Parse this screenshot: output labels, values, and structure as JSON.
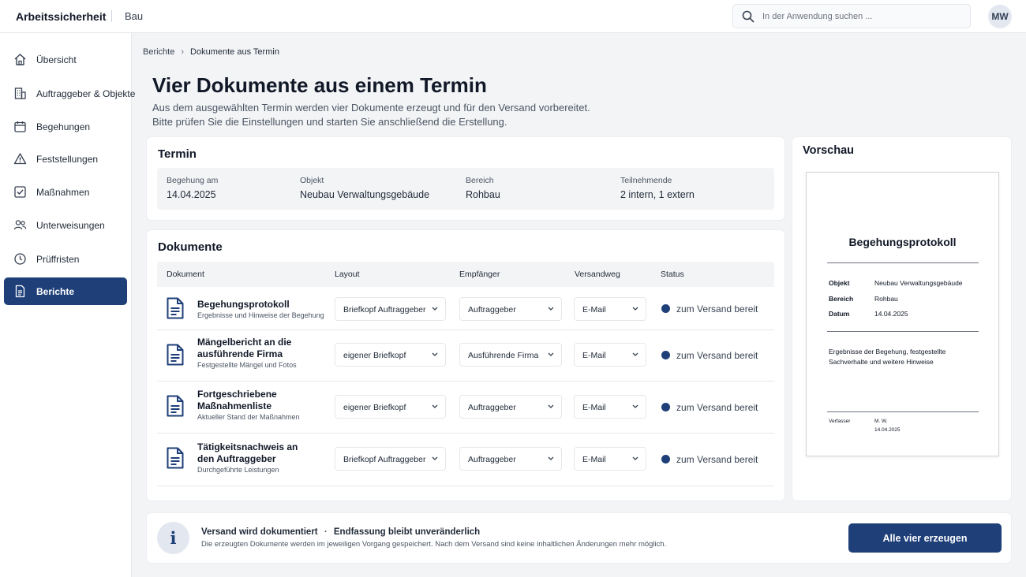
{
  "app": {
    "title": "Arbeitssicherheit",
    "subtitle": "Bau"
  },
  "search": {
    "placeholder": "In der Anwendung suchen ..."
  },
  "user": {
    "initials": "MW"
  },
  "colors": {
    "primary": "#1e3f78",
    "status_dot": "#1e3f78"
  },
  "sidebar": {
    "items": [
      {
        "label": "Übersicht",
        "icon": "home-icon",
        "active": false
      },
      {
        "label": "Auftraggeber & Objekte",
        "icon": "building-icon",
        "active": false
      },
      {
        "label": "Begehungen",
        "icon": "calendar-icon",
        "active": false
      },
      {
        "label": "Feststellungen",
        "icon": "warning-icon",
        "active": false
      },
      {
        "label": "Maßnahmen",
        "icon": "checkbox-icon",
        "active": false
      },
      {
        "label": "Unterweisungen",
        "icon": "users-icon",
        "active": false
      },
      {
        "label": "Prüffristen",
        "icon": "clock-icon",
        "active": false
      },
      {
        "label": "Berichte",
        "icon": "document-icon",
        "active": true
      }
    ]
  },
  "breadcrumb": {
    "parent": "Berichte",
    "separator": "›",
    "current": "Dokumente aus Termin"
  },
  "page": {
    "title": "Vier Dokumente aus einem Termin",
    "intro_1": "Aus dem ausgewählten Termin werden vier Dokumente erzeugt und für den Versand vorbereitet.",
    "intro_2": "Bitte prüfen Sie die Einstellungen und starten Sie anschließend die Erstellung."
  },
  "termin": {
    "heading": "Termin",
    "fields": [
      {
        "label": "Begehung am",
        "value": "14.04.2025"
      },
      {
        "label": "Objekt",
        "value": "Neubau Verwaltungsgebäude"
      },
      {
        "label": "Bereich",
        "value": "Rohbau"
      },
      {
        "label": "Teilnehmende",
        "value": "2 intern, 1 extern"
      }
    ]
  },
  "documents": {
    "heading": "Dokumente",
    "columns": {
      "doc": "Dokument",
      "layout": "Layout",
      "recipient": "Empfänger",
      "channel": "Versandweg",
      "status": "Status"
    },
    "rows": [
      {
        "name": "Begehungsprotokoll",
        "desc": "Ergebnisse und Hinweise der Begehung",
        "layout": "Briefkopf Auftraggeber",
        "recipient": "Auftraggeber",
        "channel": "E-Mail",
        "status": "zum Versand bereit"
      },
      {
        "name": "Mängelbericht an die ausführende Firma",
        "desc": "Festgestellte Mängel und Fotos",
        "layout": "eigener Briefkopf",
        "recipient": "Ausführende Firma",
        "channel": "E-Mail",
        "status": "zum Versand bereit"
      },
      {
        "name": "Fortgeschriebene Maßnahmenliste",
        "desc": "Aktueller Stand der Maßnahmen",
        "layout": "eigener Briefkopf",
        "recipient": "Auftraggeber",
        "channel": "E-Mail",
        "status": "zum Versand bereit"
      },
      {
        "name": "Tätigkeitsnachweis an den Auftraggeber",
        "desc": "Durchgeführte Leistungen",
        "layout": "Briefkopf Auftraggeber",
        "recipient": "Auftraggeber",
        "channel": "E-Mail",
        "status": "zum Versand bereit"
      }
    ]
  },
  "preview": {
    "heading": "Vorschau",
    "doc_title": "Begehungsprotokoll",
    "fields": [
      {
        "label": "Objekt",
        "value": "Neubau Verwaltungsgebäude"
      },
      {
        "label": "Bereich",
        "value": "Rohbau"
      },
      {
        "label": "Datum",
        "value": "14.04.2025"
      }
    ],
    "text": "Ergebnisse der Begehung, festgestellte Sachverhalte und weitere Hinweise",
    "author_label": "Verfasser",
    "author": "M. W.",
    "author_date": "14.04.2025"
  },
  "footer": {
    "info_glyph": "i",
    "title_1": "Versand wird dokumentiert",
    "title_sep": "·",
    "title_2": "Endfassung bleibt unveränderlich",
    "subtitle": "Die erzeugten Dokumente werden im jeweiligen Vorgang gespeichert. Nach dem Versand sind keine inhaltlichen Änderungen mehr möglich.",
    "cta": "Alle vier erzeugen"
  }
}
